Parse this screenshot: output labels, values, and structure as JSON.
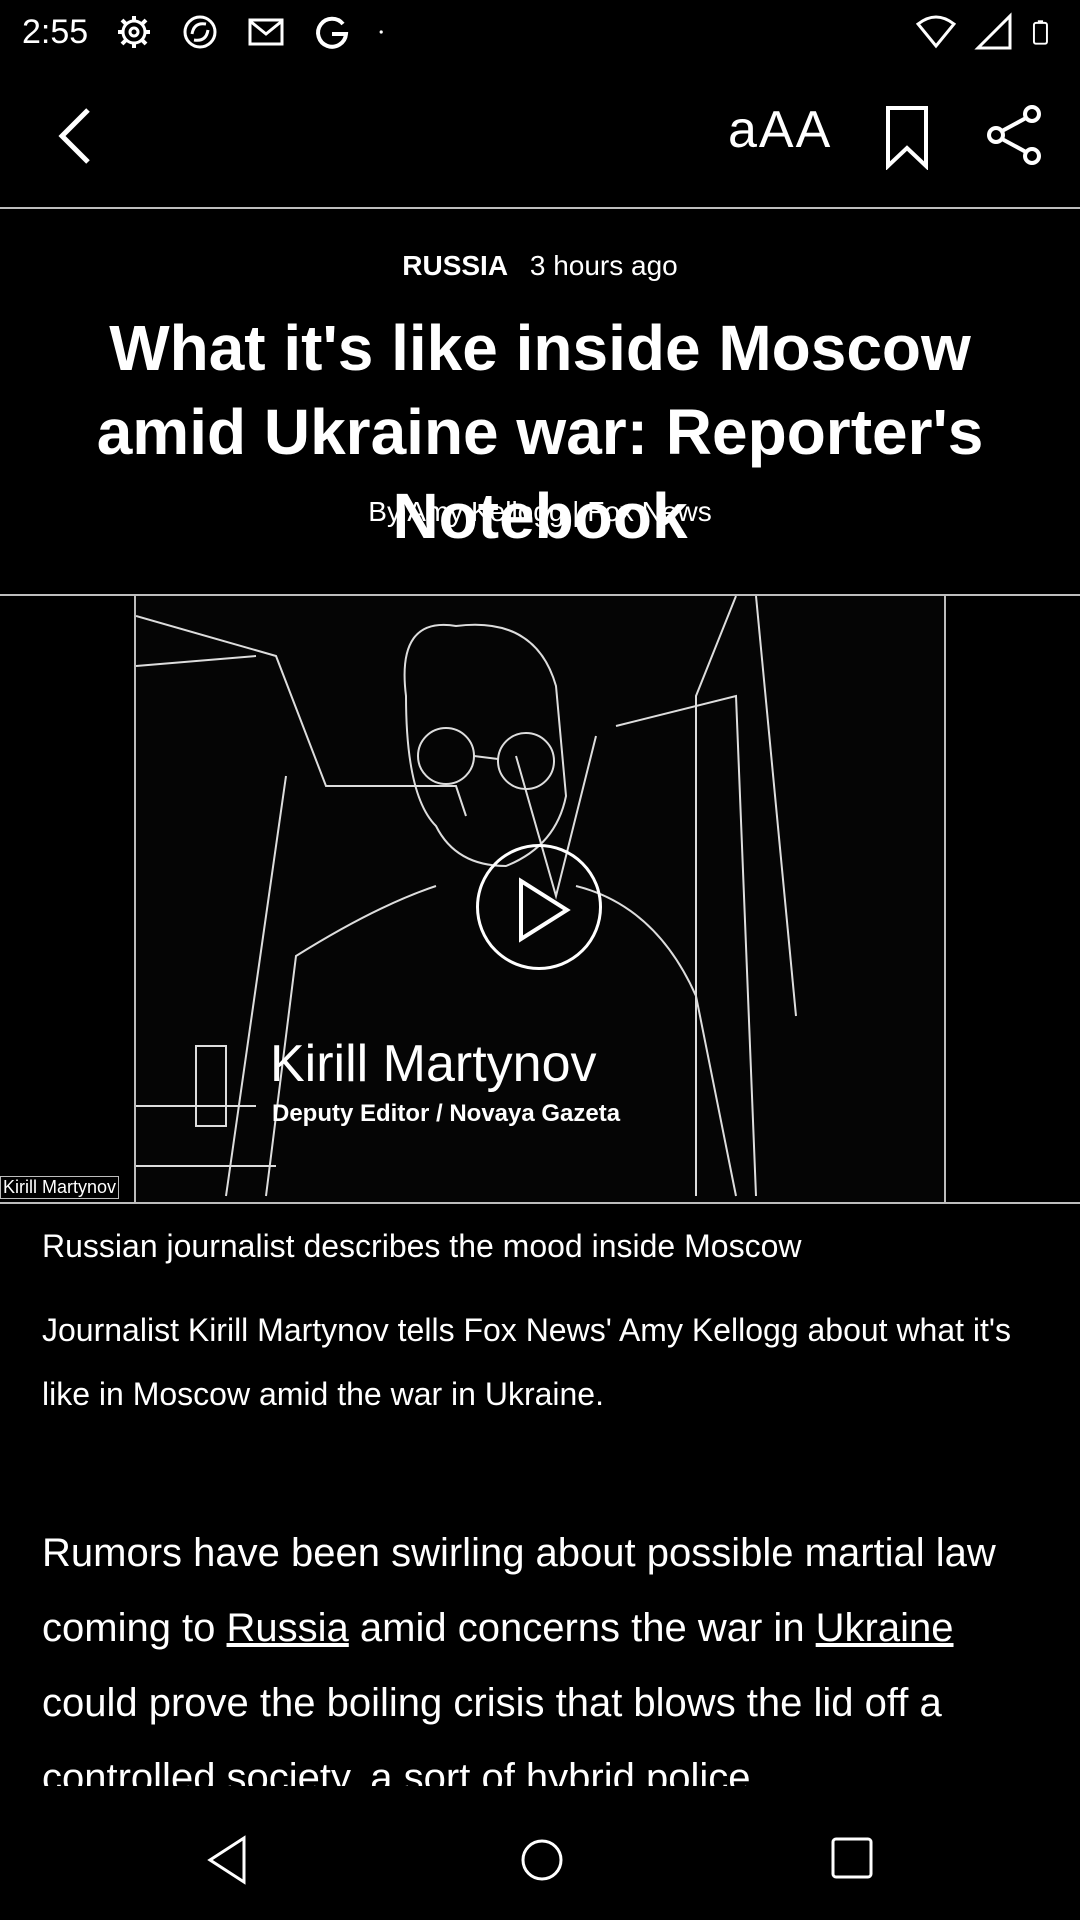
{
  "status_bar": {
    "time": "2:55",
    "left_icons": [
      "settings-icon",
      "sync-icon",
      "gmail-icon",
      "google-icon",
      "dot-icon"
    ],
    "right_icons": [
      "wifi-icon",
      "signal-icon",
      "battery-icon"
    ]
  },
  "toolbar": {
    "font_size_label": "aAA",
    "icons": [
      "back-icon",
      "font-size-icon",
      "bookmark-icon",
      "share-icon"
    ]
  },
  "article": {
    "category": "RUSSIA",
    "time_ago": "3 hours ago",
    "headline": "What it's like inside Moscow amid Ukraine war: Reporter's Notebook",
    "byline": "By Amy Kellogg | Fox News",
    "body_before_link1": "Rumors have been swirling about possible martial law coming to ",
    "link1": "Russia",
    "body_between": " amid concerns the war in ",
    "link2": "Ukraine",
    "body_after_link2": " could prove the boiling crisis that blows the lid off a controlled society, a sort of hybrid police"
  },
  "video": {
    "lower_third_name": "Kirill Martynov",
    "lower_third_title": "Deputy Editor / Novaya Gazeta",
    "corner_caption": "Kirill Martynov",
    "title": "Russian journalist describes the mood inside Moscow",
    "description": "Journalist Kirill Martynov tells Fox News' Amy Kellogg about what it's like in Moscow amid the war in Ukraine."
  },
  "nav_bar": {
    "icons": [
      "nav-back-icon",
      "nav-home-icon",
      "nav-recents-icon"
    ]
  }
}
